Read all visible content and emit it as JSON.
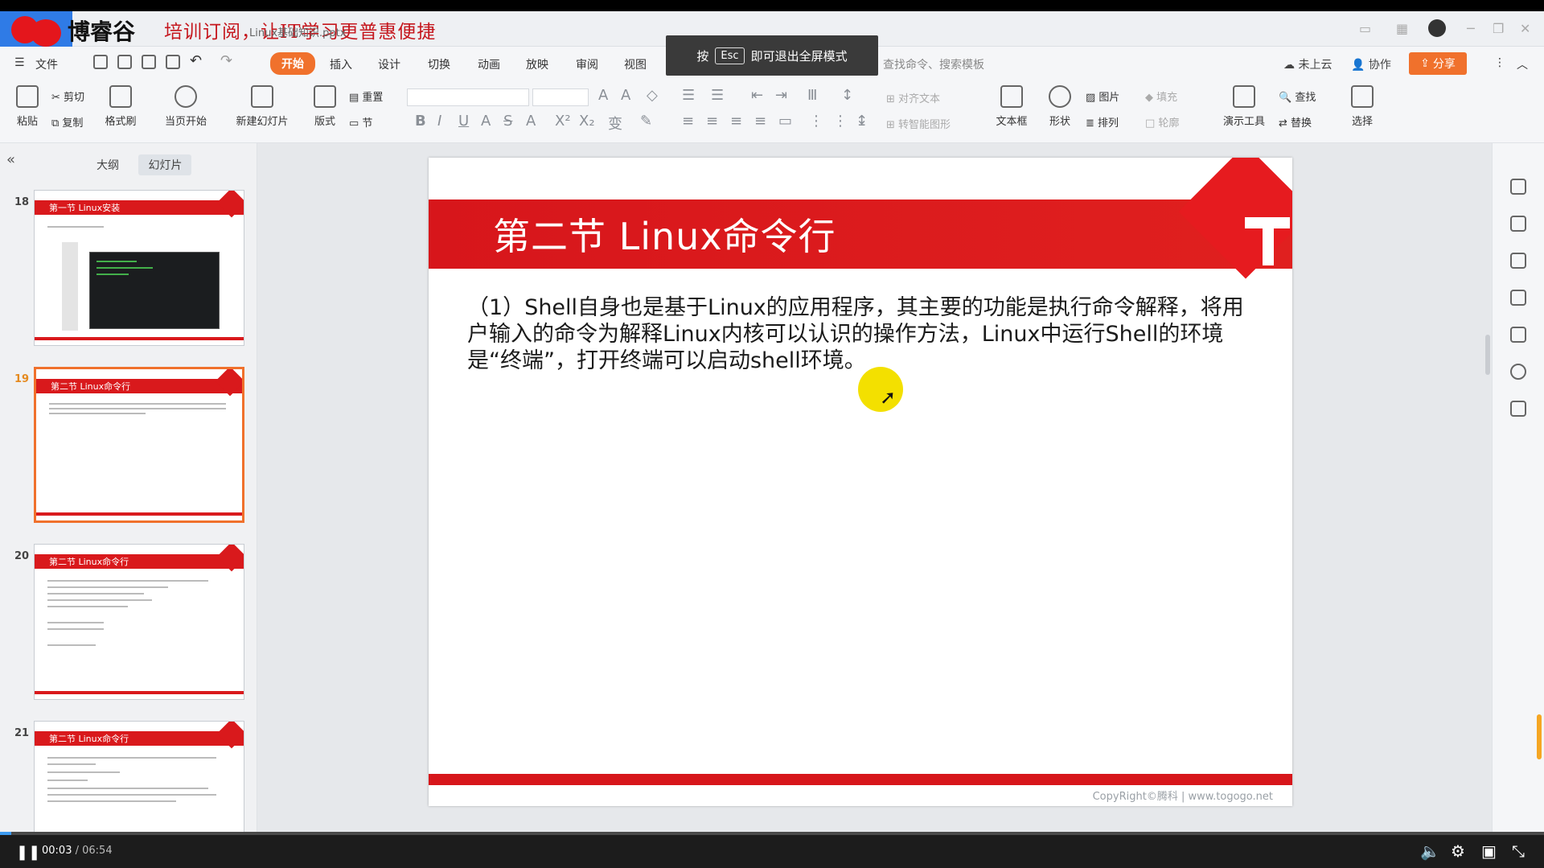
{
  "app": {
    "brand": "博睿谷",
    "slogan": "培训订阅，让IT学习更普惠便捷",
    "file_tab": "Linux基础知识.pptx"
  },
  "fullscreen_tip": {
    "prefix": "按",
    "key": "Esc",
    "suffix": "即可退出全屏模式"
  },
  "menu": {
    "file": "文件",
    "tabs": [
      "开始",
      "插入",
      "设计",
      "切换",
      "动画",
      "放映",
      "审阅",
      "视图"
    ],
    "active_tab": "开始",
    "search_hint": "查找命令、搜索模板",
    "cloud": "未上云",
    "collab": "协作",
    "share": "分享"
  },
  "ribbon": {
    "paste": "粘贴",
    "cut": "剪切",
    "copy": "复制",
    "format_painter": "格式刷",
    "play_current": "当页开始",
    "new_slide": "新建幻灯片",
    "layout": "版式",
    "reset": "重置",
    "section": "节",
    "align_text": "对齐文本",
    "smartart": "转智能图形",
    "textbox": "文本框",
    "shape": "形状",
    "picture": "图片",
    "fill": "填充",
    "arrange": "排列",
    "outline": "轮廓",
    "present_tools": "演示工具",
    "find": "查找",
    "replace": "替换",
    "select": "选择"
  },
  "left_pane": {
    "tab_outline": "大纲",
    "tab_slides": "幻灯片",
    "thumbnails": [
      {
        "num": "18",
        "title": "第一节  Linux安装"
      },
      {
        "num": "19",
        "title": "第二节  Linux命令行"
      },
      {
        "num": "20",
        "title": "第二节  Linux命令行"
      },
      {
        "num": "21",
        "title": "第二节  Linux命令行"
      }
    ]
  },
  "slide": {
    "title": "第二节  Linux命令行",
    "body": "（1）Shell自身也是基于Linux的应用程序，其主要的功能是执行命令解释，将用户输入的命令为解释Linux内核可以认识的操作方法，Linux中运行Shell的环境是“终端”，打开终端可以启动shell环境。",
    "copyright": "CopyRight©腾科 | www.togogo.net"
  },
  "video": {
    "current": "00:03",
    "separator": " / ",
    "total": "06:54",
    "progress": 0.007
  },
  "colors": {
    "brand_red": "#d7161b",
    "accent_orange": "#f0712c",
    "progress_blue": "#3d9bf0"
  }
}
